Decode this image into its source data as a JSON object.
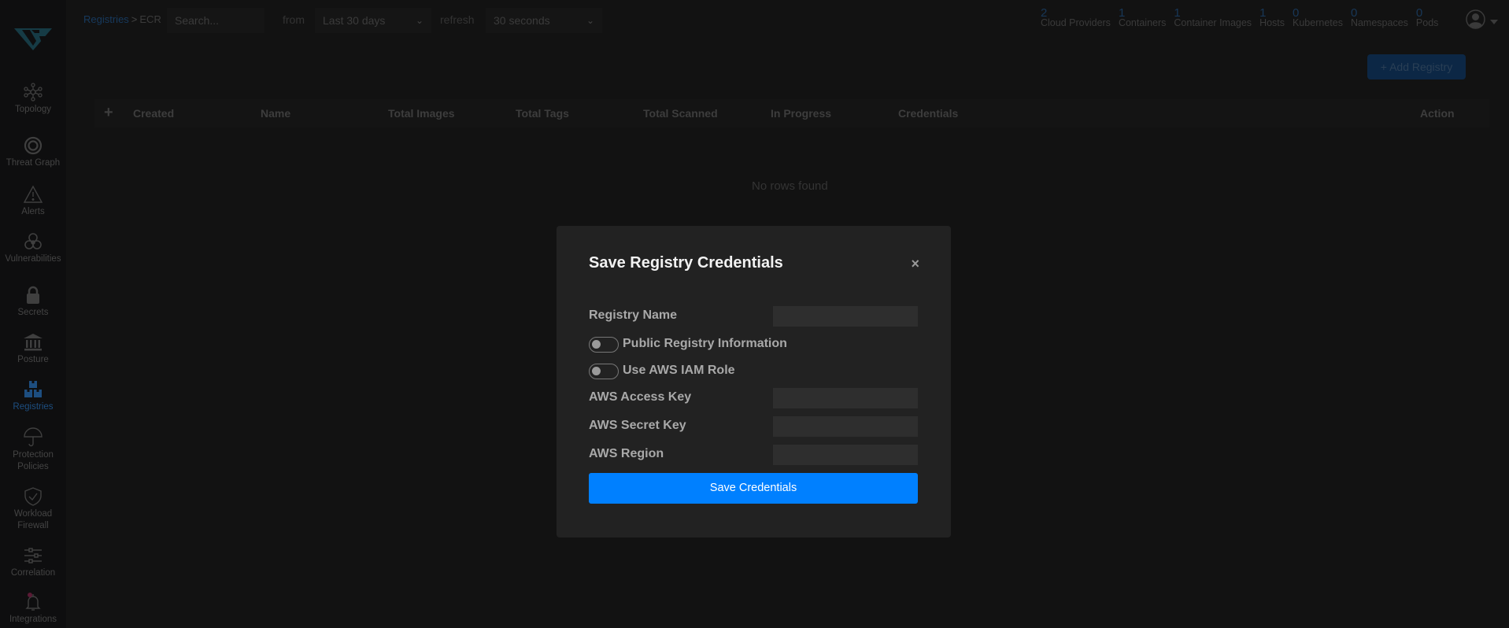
{
  "sidebar": {
    "items": [
      {
        "label": "Topology",
        "icon": "topology-icon",
        "active": false
      },
      {
        "label": "Threat Graph",
        "icon": "target-icon",
        "active": false
      },
      {
        "label": "Alerts",
        "icon": "warning-icon",
        "active": false
      },
      {
        "label": "Vulnerabilities",
        "icon": "biohazard-icon",
        "active": false
      },
      {
        "label": "Secrets",
        "icon": "lock-icon",
        "active": false
      },
      {
        "label": "Posture",
        "icon": "bank-icon",
        "active": false
      },
      {
        "label": "Registries",
        "icon": "boxes-icon",
        "active": true
      },
      {
        "label": "Protection Policies",
        "line1": "Protection",
        "line2": "Policies",
        "icon": "umbrella-icon",
        "active": false
      },
      {
        "label": "Workload Firewall",
        "line1": "Workload",
        "line2": "Firewall",
        "icon": "shield-check-icon",
        "active": false
      },
      {
        "label": "Correlation",
        "icon": "sliders-icon",
        "active": false
      },
      {
        "label": "Integrations",
        "icon": "bell-icon",
        "active": false
      }
    ]
  },
  "topbar": {
    "breadcrumb": {
      "parent": "Registries",
      "separator": ">",
      "current": "ECR"
    },
    "search_placeholder": "Search...",
    "from_label": "from",
    "time_range": "Last 30 days",
    "refresh_label": "refresh",
    "refresh_interval": "30 seconds",
    "stats": [
      {
        "count": "2",
        "label": "Cloud Providers"
      },
      {
        "count": "1",
        "label": "Containers"
      },
      {
        "count": "1",
        "label": "Container Images"
      },
      {
        "count": "1",
        "label": "Hosts"
      },
      {
        "count": "0",
        "label": "Kubernetes"
      },
      {
        "count": "0",
        "label": "Namespaces"
      },
      {
        "count": "0",
        "label": "Pods"
      }
    ]
  },
  "main": {
    "add_registry_label": "+ Add Registry",
    "table": {
      "expand_symbol": "+",
      "columns": [
        "Created",
        "Name",
        "Total Images",
        "Total Tags",
        "Total Scanned",
        "In Progress",
        "Credentials",
        "Action"
      ],
      "empty_text": "No rows found"
    }
  },
  "modal": {
    "title": "Save Registry Credentials",
    "close_symbol": "×",
    "fields": {
      "registry_name": {
        "label": "Registry Name",
        "value": ""
      },
      "public_registry": {
        "label": "Public Registry Information",
        "enabled": false
      },
      "use_iam_role": {
        "label": "Use AWS IAM Role",
        "enabled": false
      },
      "access_key": {
        "label": "AWS Access Key",
        "value": ""
      },
      "secret_key": {
        "label": "AWS Secret Key",
        "value": ""
      },
      "region": {
        "label": "AWS Region",
        "value": ""
      }
    },
    "submit_label": "Save Credentials"
  },
  "colors": {
    "accent": "#0080ff",
    "modal_bg": "#222222",
    "page_bg": "#121212",
    "active_nav": "#1d4e80"
  }
}
